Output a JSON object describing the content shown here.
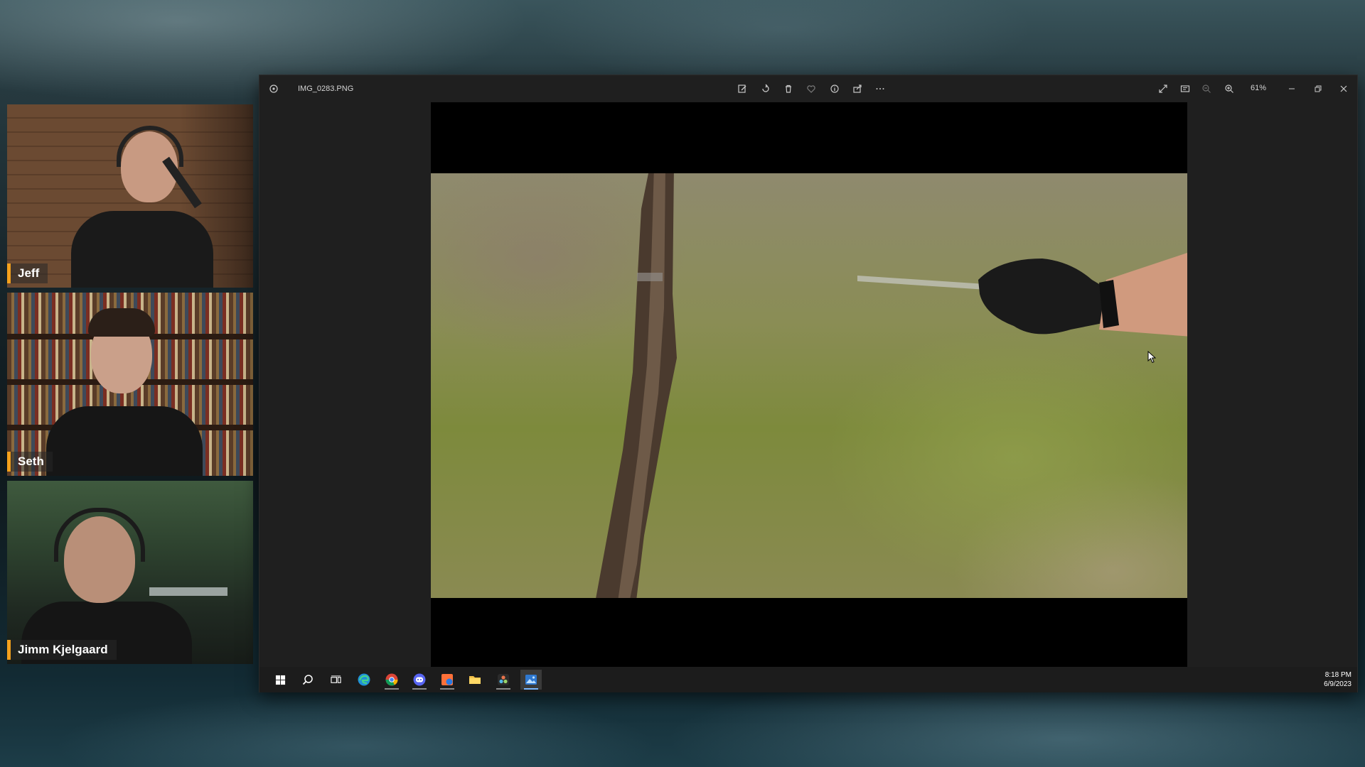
{
  "participants": [
    {
      "name": "Jeff"
    },
    {
      "name": "Seth"
    },
    {
      "name": "Jimm Kjelgaard"
    }
  ],
  "photos_app": {
    "file_name": "IMG_0283.PNG",
    "zoom": "61%",
    "toolbar_icons": [
      "edit-icon",
      "rotate-icon",
      "delete-icon",
      "favorite-icon",
      "info-icon",
      "share-icon",
      "more-icon"
    ],
    "view_controls": [
      "fullscreen-icon",
      "slideshow-icon",
      "zoom-out-icon",
      "zoom-in-icon"
    ],
    "window_controls": [
      "minimize-icon",
      "restore-icon",
      "close-icon"
    ]
  },
  "taskbar": {
    "apps": [
      "windows-start-icon",
      "search-icon",
      "task-view-icon",
      "edge-icon",
      "chrome-icon",
      "discord-icon",
      "firefox-icon",
      "file-explorer-icon",
      "davinci-resolve-icon",
      "photos-icon"
    ],
    "active_app": "photos-icon",
    "time": "8:18 PM",
    "date": "6/9/2023"
  },
  "colors": {
    "name_tag_accent": "#f4a11c",
    "window_bg": "#1f1f1f",
    "taskbar_bg": "#1c1c1c"
  }
}
